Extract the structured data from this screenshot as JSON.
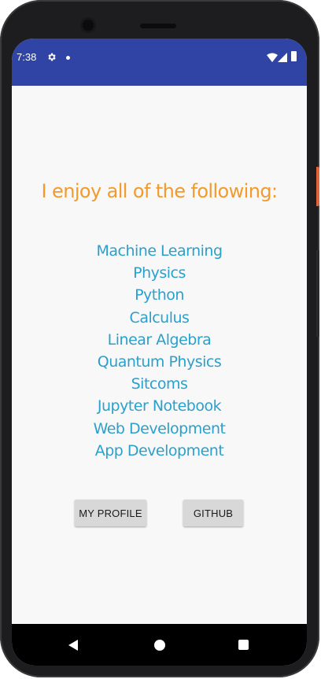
{
  "status_bar": {
    "time": "7:38",
    "icons": [
      "gear-icon",
      "notification-dot-icon",
      "wifi-icon",
      "signal-icon",
      "battery-icon"
    ],
    "background_color": "#2f44a4"
  },
  "main": {
    "headline": "I enjoy all of the following:",
    "headline_color": "#f39a2c",
    "interests": [
      "Machine Learning",
      "Physics",
      "Python",
      "Calculus",
      "Linear Algebra",
      "Quantum Physics",
      "Sitcoms",
      "Jupyter Notebook",
      "Web Development",
      "App Development"
    ],
    "interest_color": "#2aa0cc",
    "buttons": {
      "profile_label": "MY PROFILE",
      "github_label": "GITHUB"
    }
  },
  "nav_bar": {
    "icons": [
      "back-icon",
      "home-icon",
      "recents-icon"
    ]
  }
}
